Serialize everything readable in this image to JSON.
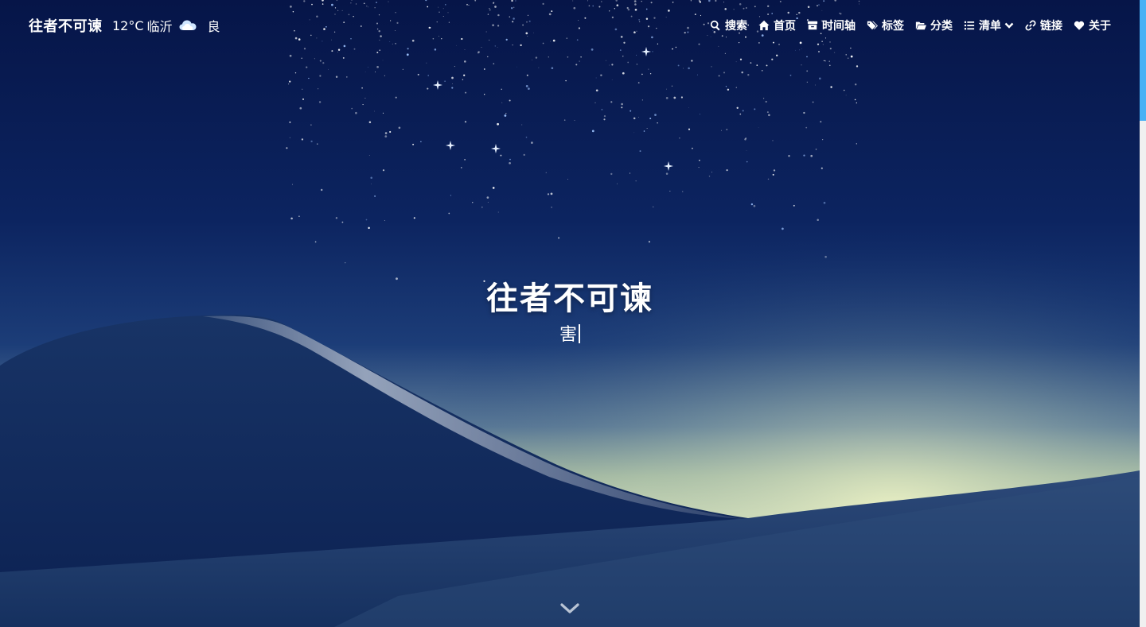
{
  "brand": "往者不可谏",
  "weather": {
    "temperature": "12°C",
    "city": "临沂",
    "icon": "cloud-icon",
    "air_quality": "良"
  },
  "nav": [
    {
      "label": "搜索",
      "icon": "search-icon"
    },
    {
      "label": "首页",
      "icon": "home-icon"
    },
    {
      "label": "时间轴",
      "icon": "archive-icon"
    },
    {
      "label": "标签",
      "icon": "tags-icon"
    },
    {
      "label": "分类",
      "icon": "folder-icon"
    },
    {
      "label": "清单",
      "icon": "list-icon",
      "dropdown": true
    },
    {
      "label": "链接",
      "icon": "link-icon"
    },
    {
      "label": "关于",
      "icon": "heart-icon"
    }
  ],
  "hero": {
    "title": "往者不可谏",
    "subtitle": "害"
  },
  "colors": {
    "sky_top": "#07174a",
    "sky_mid": "#123171",
    "horizon_glow": "#e3edbe",
    "accent": "#49b1f5"
  }
}
